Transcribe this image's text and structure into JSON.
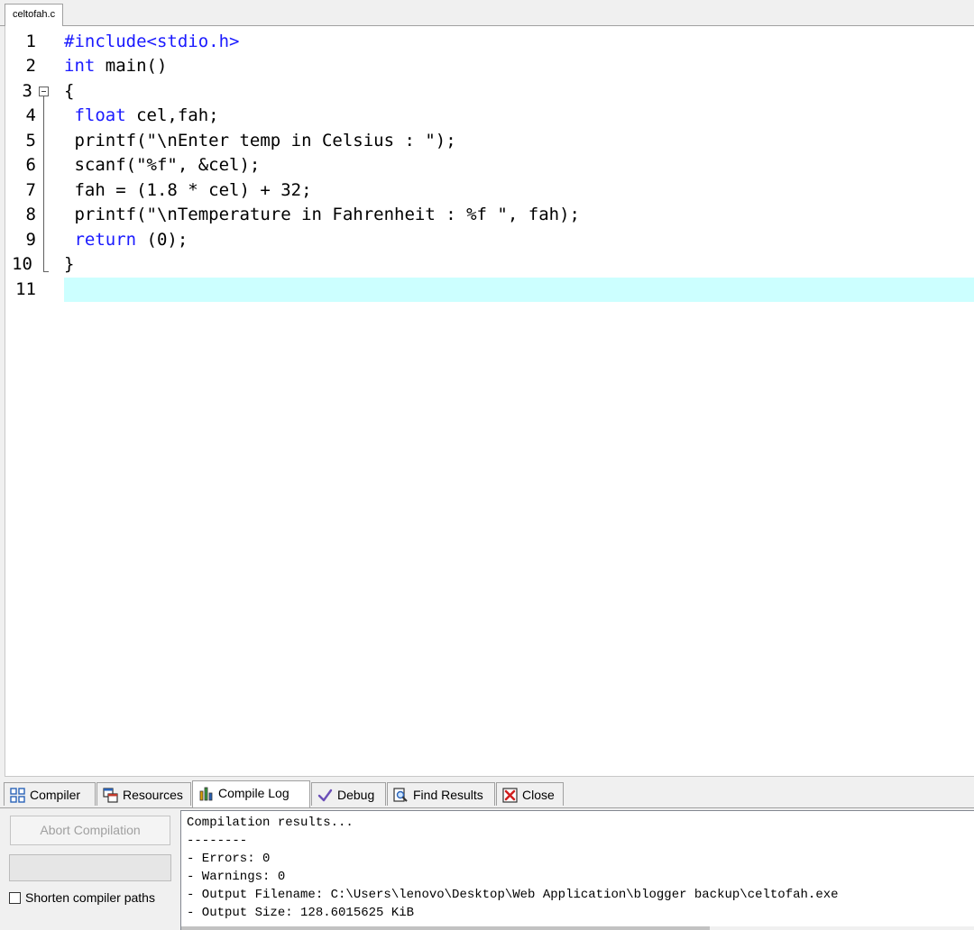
{
  "file_tab": {
    "label": "celtofah.c"
  },
  "editor": {
    "lines": [
      {
        "num": "1"
      },
      {
        "num": "2"
      },
      {
        "num": "3"
      },
      {
        "num": "4"
      },
      {
        "num": "5"
      },
      {
        "num": "6"
      },
      {
        "num": "7"
      },
      {
        "num": "8"
      },
      {
        "num": "9"
      },
      {
        "num": "10"
      },
      {
        "num": "11"
      }
    ],
    "code": {
      "l1": "#include<stdio.h>",
      "l2_kw": "int",
      "l2_rest": " main()",
      "l3": "{",
      "l4_kw": " float",
      "l4_rest": " cel,fah;",
      "l5": " printf(\"\\nEnter temp in Celsius : \");",
      "l6": " scanf(\"%f\", &cel);",
      "l7": " fah = (1.8 * cel) + 32;",
      "l8": " printf(\"\\nTemperature in Fahrenheit : %f \", fah);",
      "l9_kw": " return",
      "l9_rest": " (0);",
      "l10": "}",
      "l11": ""
    },
    "active_line": 11,
    "colors": {
      "keyword": "#1a1aff",
      "active_line_bg": "#ccffff"
    }
  },
  "panel_tabs": [
    {
      "label": "Compiler",
      "icon": "grid-icon"
    },
    {
      "label": "Resources",
      "icon": "windows-icon"
    },
    {
      "label": "Compile Log",
      "icon": "bar-chart-icon",
      "active": true
    },
    {
      "label": "Debug",
      "icon": "checkmark-icon"
    },
    {
      "label": "Find Results",
      "icon": "find-document-icon"
    },
    {
      "label": "Close",
      "icon": "close-icon"
    }
  ],
  "controls": {
    "abort_label": "Abort Compilation",
    "shorten_label": "Shorten compiler paths",
    "shorten_checked": false
  },
  "log": {
    "lines": [
      "Compilation results...",
      "--------",
      "- Errors: 0",
      "- Warnings: 0",
      "- Output Filename: C:\\Users\\lenovo\\Desktop\\Web Application\\blogger backup\\celtofah.exe",
      "- Output Size: 128.6015625 KiB"
    ]
  }
}
